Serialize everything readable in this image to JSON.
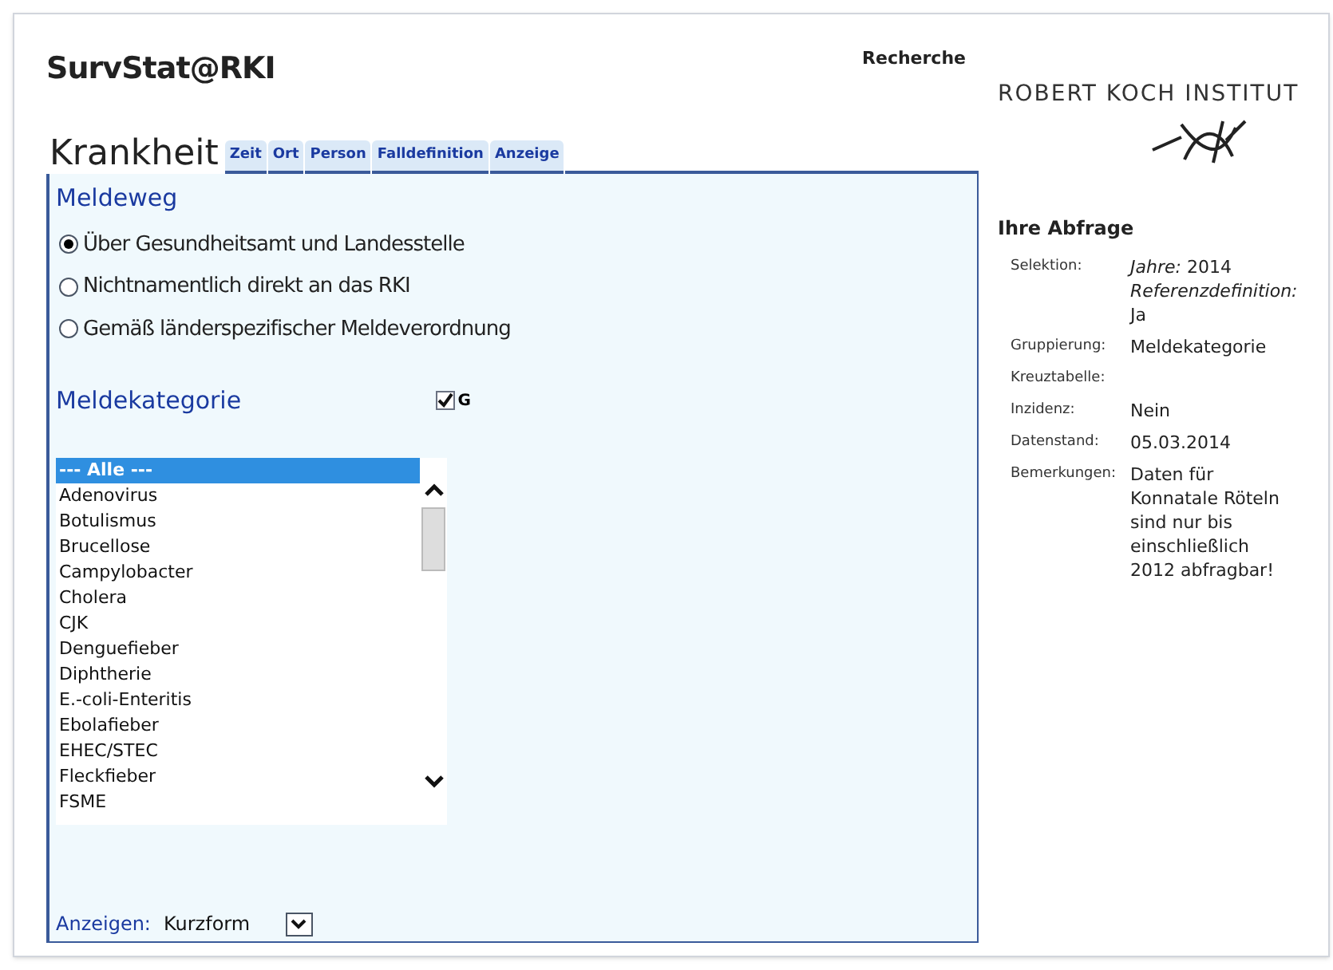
{
  "header": {
    "title": "SurvStat@RKI",
    "link": "Recherche",
    "logo_text": "ROBERT KOCH INSTITUT"
  },
  "tabs": [
    {
      "label": "Krankheit",
      "selected": true
    },
    {
      "label": "Zeit",
      "selected": false
    },
    {
      "label": "Ort",
      "selected": false
    },
    {
      "label": "Person",
      "selected": false
    },
    {
      "label": "Falldefinition",
      "selected": false
    },
    {
      "label": "Anzeige",
      "selected": false
    }
  ],
  "meldeweg": {
    "heading": "Meldeweg",
    "options": [
      {
        "label": "Über Gesundheitsamt und Landesstelle",
        "selected": true
      },
      {
        "label": "Nichtnamentlich direkt an das RKI",
        "selected": false
      },
      {
        "label": "Gemäß länderspezifischer Meldeverordnung",
        "selected": false
      }
    ]
  },
  "meldekategorie": {
    "heading": "Meldekategorie",
    "checkbox": {
      "label": "G",
      "checked": true
    },
    "items": [
      {
        "label": "--- Alle ---",
        "selected": true
      },
      {
        "label": "Adenovirus",
        "selected": false
      },
      {
        "label": "Botulismus",
        "selected": false
      },
      {
        "label": "Brucellose",
        "selected": false
      },
      {
        "label": "Campylobacter",
        "selected": false
      },
      {
        "label": "Cholera",
        "selected": false
      },
      {
        "label": "CJK",
        "selected": false
      },
      {
        "label": "Denguefieber",
        "selected": false
      },
      {
        "label": "Diphtherie",
        "selected": false
      },
      {
        "label": "E.-coli-Enteritis",
        "selected": false
      },
      {
        "label": "Ebolafieber",
        "selected": false
      },
      {
        "label": "EHEC/STEC",
        "selected": false
      },
      {
        "label": "Fleckfieber",
        "selected": false
      },
      {
        "label": "FSME",
        "selected": false
      }
    ]
  },
  "anzeigen": {
    "label": "Anzeigen:",
    "value": "Kurzform"
  },
  "abfrage": {
    "heading": "Ihre Abfrage",
    "rows": [
      {
        "label": "Selektion:",
        "value": "*Jahre:* 2014 *Referenzdefinition:* Ja"
      },
      {
        "label": "Gruppierung:",
        "value": "Meldekategorie"
      },
      {
        "label": "Kreuztabelle:"
      },
      {
        "label": "Inzidenz:",
        "value": "Nein"
      },
      {
        "label": "Datenstand:",
        "value": "05.03.2014"
      },
      {
        "label": "Bemerkungen:",
        "value": "Daten für Konnatale Röteln sind nur bis einschließlich 2012 abfragbar!"
      }
    ]
  }
}
